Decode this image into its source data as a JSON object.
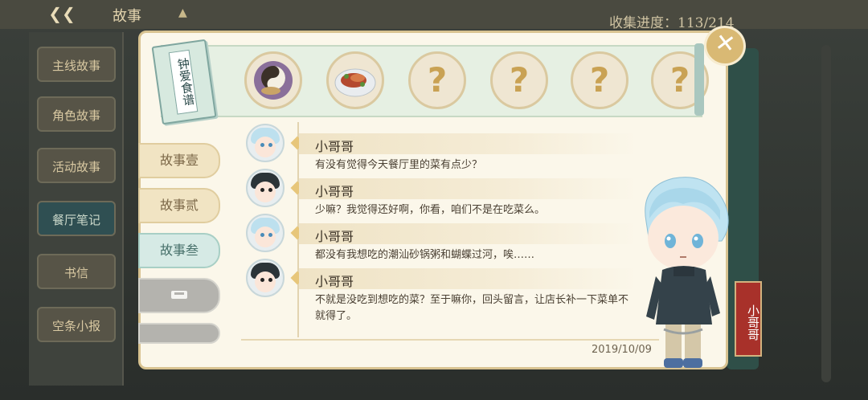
{
  "background": {
    "title": "故事",
    "progress": "收集进度：113/214",
    "side_tabs": [
      "主线故事",
      "角色故事",
      "活动故事",
      "餐厅笔记",
      "书信",
      "空条小报"
    ],
    "active_side_tab": "餐厅笔记"
  },
  "recipe_book": {
    "label": "钟爱食谱",
    "dishes": [
      {
        "icon": "tea-eggs-dish-icon",
        "unknown": false
      },
      {
        "icon": "roast-meat-dish-icon",
        "unknown": false
      },
      {
        "icon": "unknown-dish-icon",
        "unknown": true,
        "mark": "?"
      },
      {
        "icon": "unknown-dish-icon",
        "unknown": true,
        "mark": "?"
      },
      {
        "icon": "unknown-dish-icon",
        "unknown": true,
        "mark": "?"
      },
      {
        "icon": "unknown-dish-icon",
        "unknown": true,
        "mark": "?"
      }
    ]
  },
  "story_tabs": [
    {
      "label": "故事壹",
      "state": "unlocked"
    },
    {
      "label": "故事贰",
      "state": "unlocked"
    },
    {
      "label": "故事叁",
      "state": "selected"
    },
    {
      "label": "",
      "state": "locked"
    },
    {
      "label": "",
      "state": "locked"
    }
  ],
  "messages": [
    {
      "speaker": "小哥哥",
      "avatar": "light",
      "text": "有没有觉得今天餐厅里的菜有点少？"
    },
    {
      "speaker": "小哥哥",
      "avatar": "dark",
      "text": "少嘛？我觉得还好啊，你看，咱们不是在吃菜么。"
    },
    {
      "speaker": "小哥哥",
      "avatar": "light",
      "text": "都没有我想吃的潮汕砂锅粥和蝴蝶过河，唉……"
    },
    {
      "speaker": "小哥哥",
      "avatar": "dark",
      "text": "不就是没吃到想吃的菜？至于嘛你，回头留言，让店长补一下菜单不就得了。"
    }
  ],
  "date": "2019/10/09",
  "character_name": "小哥哥",
  "colors": {
    "accent": "#d9b974",
    "nameplate": "#a8312a",
    "banner": "#e6f0e3"
  }
}
